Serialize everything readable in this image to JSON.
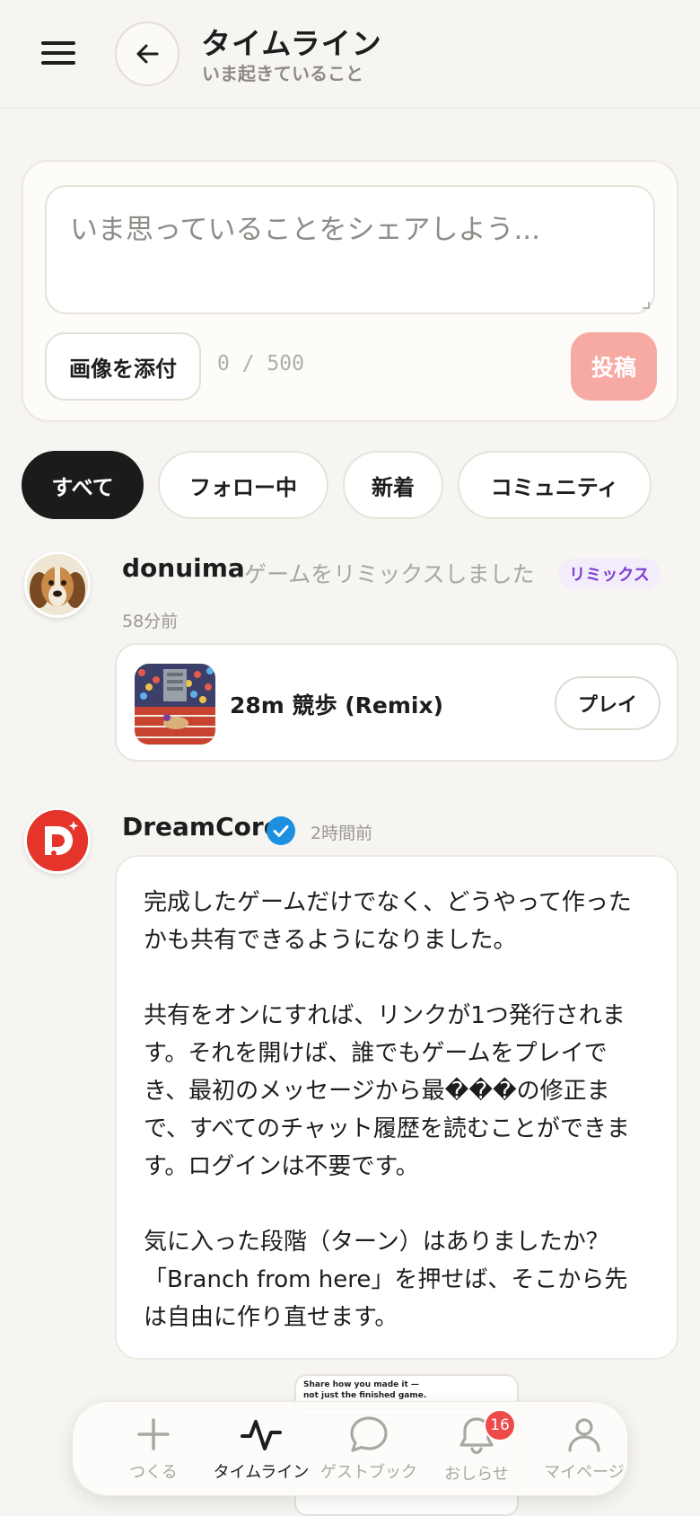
{
  "header": {
    "title": "タイムライン",
    "subtitle": "いま起きていること"
  },
  "composer": {
    "placeholder": "いま思っていることをシェアしよう...",
    "attach_label": "画像を添付",
    "char_count": "0 / 500",
    "post_label": "投稿"
  },
  "filters": {
    "all": "すべて",
    "following": "フォロー中",
    "new": "新着",
    "community": "コミュニティ",
    "active": "すべて"
  },
  "feed": [
    {
      "username": "donuima",
      "action": "ゲームをリミックスしました",
      "badge": "リミックス",
      "time": "58分前",
      "game_title": "28m 競歩 (Remix)",
      "play_label": "プレイ"
    },
    {
      "username": "DreamCore",
      "verified": true,
      "time": "2時間前",
      "paragraphs": [
        "完成したゲームだけでなく、どうやって作ったかも共有できるようになりました。",
        "共有をオンにすれば、リンクが1つ発行されます。それを開けば、誰でもゲームをプレイでき、最初のメッセージから最���の修正まで、すべてのチャット履歴を読むことができます。ログインは不要です。",
        "気に入った段階（ターン）はありましたか？「Branch from here」を押せば、そこから先は自由に作り直せます。"
      ],
      "preview_text": "Share how you made it —\nnot just the finished game."
    }
  ],
  "bottom_nav": {
    "create": "つくる",
    "timeline": "タイムライン",
    "guestbook": "ゲストブック",
    "notifications": "おしらせ",
    "notification_count": "16",
    "mypage": "マイページ"
  },
  "colors": {
    "accent_red": "#e5352b",
    "post_button": "#f7a9a3",
    "remix_badge_text": "#7b3fd1",
    "verified_blue": "#1d8fe0"
  }
}
